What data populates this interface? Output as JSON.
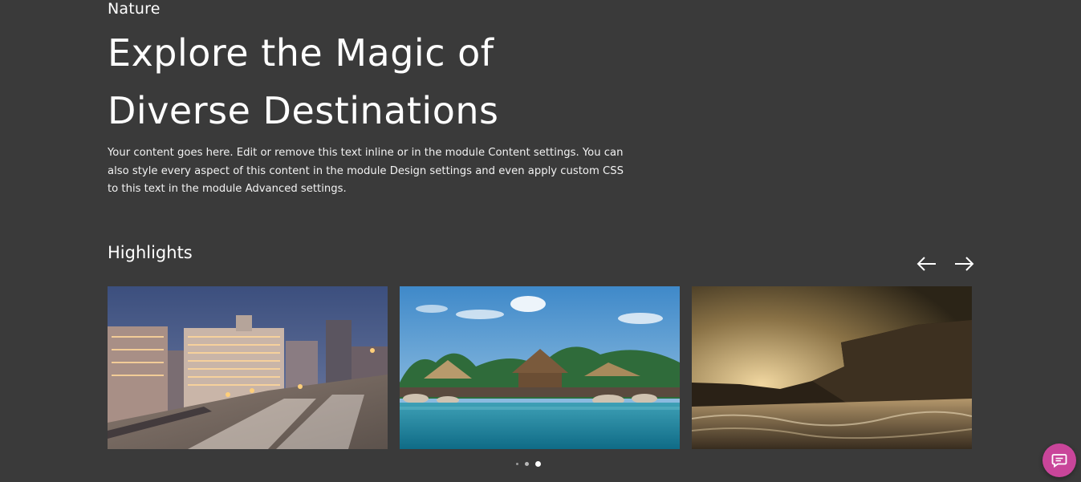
{
  "hero": {
    "eyebrow": "Nature",
    "title": "Explore the Magic of Diverse Destinations",
    "body": "Your content goes here. Edit or remove this text inline or in the module Content settings. You can also style every aspect of this content in the module Design settings and even apply custom CSS to this text in the module Advanced settings."
  },
  "highlights": {
    "heading": "Highlights",
    "prev_icon": "arrow-left-icon",
    "next_icon": "arrow-right-icon",
    "slides": [
      {
        "name": "city-night-highway-image"
      },
      {
        "name": "tropical-resort-beach-image"
      },
      {
        "name": "coastal-cliff-sunset-image"
      }
    ],
    "dots": 3,
    "active_dot": 3
  },
  "chat": {
    "icon": "chat-bubble-icon",
    "color": "#c9459a"
  },
  "colors": {
    "background": "#3a3a3a",
    "text": "#ffffff"
  }
}
